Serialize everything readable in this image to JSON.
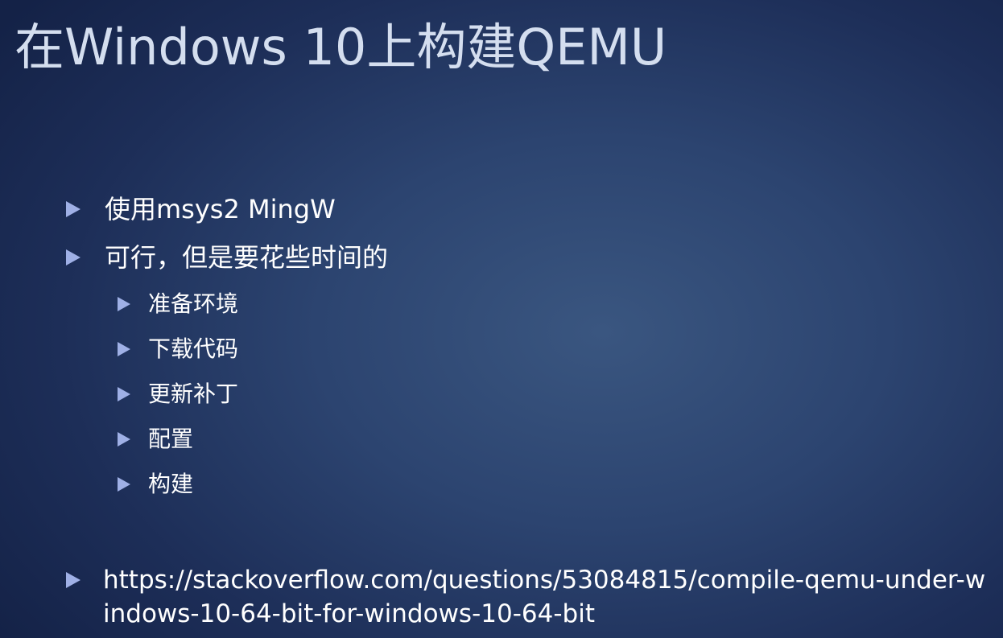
{
  "slide": {
    "title": "在Windows 10上构建QEMU",
    "bullets": [
      {
        "text": "使用msys2 MingW"
      },
      {
        "text": "可行，但是要花些时间的"
      }
    ],
    "sub_bullets": [
      {
        "text": "准备环境"
      },
      {
        "text": "下载代码"
      },
      {
        "text": "更新补丁"
      },
      {
        "text": "配置"
      },
      {
        "text": "构建"
      }
    ],
    "link": {
      "text": "https://stackoverflow.com/questions/53084815/compile-qemu-under-windows-10-64-bit-for-windows-10-64-bit"
    }
  },
  "colors": {
    "background_center": "#3a5680",
    "background_edge": "#142247",
    "title": "#d4deef",
    "bullet": "#9fb0e6",
    "text": "#ffffff"
  },
  "icons": {
    "bullet_marker": "right-triangle-bullet-icon"
  }
}
